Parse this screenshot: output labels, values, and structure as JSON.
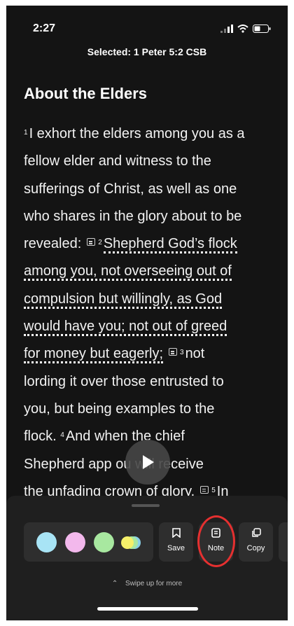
{
  "status_bar": {
    "time": "2:27"
  },
  "header": {
    "selected_text": "Selected: 1 Peter 5:2 CSB"
  },
  "passage": {
    "heading": "About the Elders",
    "lines": [
      {
        "parts": [
          {
            "t": "vn",
            "v": "1"
          },
          {
            "t": "tx",
            "v": "I exhort the elders among you as a"
          }
        ]
      },
      {
        "parts": [
          {
            "t": "tx",
            "v": "fellow elder and witness  to the"
          }
        ]
      },
      {
        "parts": [
          {
            "t": "tx",
            "v": "sufferings of Christ, as well as one"
          }
        ]
      },
      {
        "parts": [
          {
            "t": "tx",
            "v": "who shares in the glory about to be"
          }
        ]
      },
      {
        "parts": [
          {
            "t": "tx",
            "v": "revealed:"
          },
          {
            "t": "ni"
          },
          {
            "t": "vn",
            "v": "2"
          },
          {
            "t": "hl",
            "v": "Shepherd God’s flock"
          }
        ]
      },
      {
        "parts": [
          {
            "t": "hl",
            "v": "among you,  not overseeing  out of"
          }
        ]
      },
      {
        "parts": [
          {
            "t": "hl",
            "v": "compulsion but willingly, as God"
          }
        ]
      },
      {
        "parts": [
          {
            "t": "hl",
            "v": "would have you;  not out of greed"
          }
        ]
      },
      {
        "parts": [
          {
            "t": "hl",
            "v": "for money but eagerly;"
          },
          {
            "t": "ni"
          },
          {
            "t": "vn",
            "v": "3"
          },
          {
            "t": "tx",
            "v": "not"
          }
        ]
      },
      {
        "parts": [
          {
            "t": "tx",
            "v": "lording it over those entrusted to"
          }
        ]
      },
      {
        "parts": [
          {
            "t": "tx",
            "v": "you, but being examples to the"
          }
        ]
      },
      {
        "parts": [
          {
            "t": "tx",
            "v": "flock. "
          },
          {
            "t": "vn",
            "v": "4"
          },
          {
            "t": "tx",
            "v": "And when the chief"
          }
        ]
      },
      {
        "parts": [
          {
            "t": "tx",
            "v": "Shepherd  app          ou will receive"
          }
        ]
      },
      {
        "parts": [
          {
            "t": "tx",
            "v": "the unfading crown  of glory."
          },
          {
            "t": "ni"
          },
          {
            "t": "vn",
            "v": "5"
          },
          {
            "t": "tx",
            "v": "In"
          }
        ]
      }
    ]
  },
  "toolbar": {
    "highlight_colors": [
      "#a8e4f5",
      "#f3b8ec",
      "#a8e8a0",
      "#f5f06a"
    ],
    "save_label": "Save",
    "note_label": "Note",
    "copy_label": "Copy",
    "swipe_hint": "Swipe up for more"
  }
}
